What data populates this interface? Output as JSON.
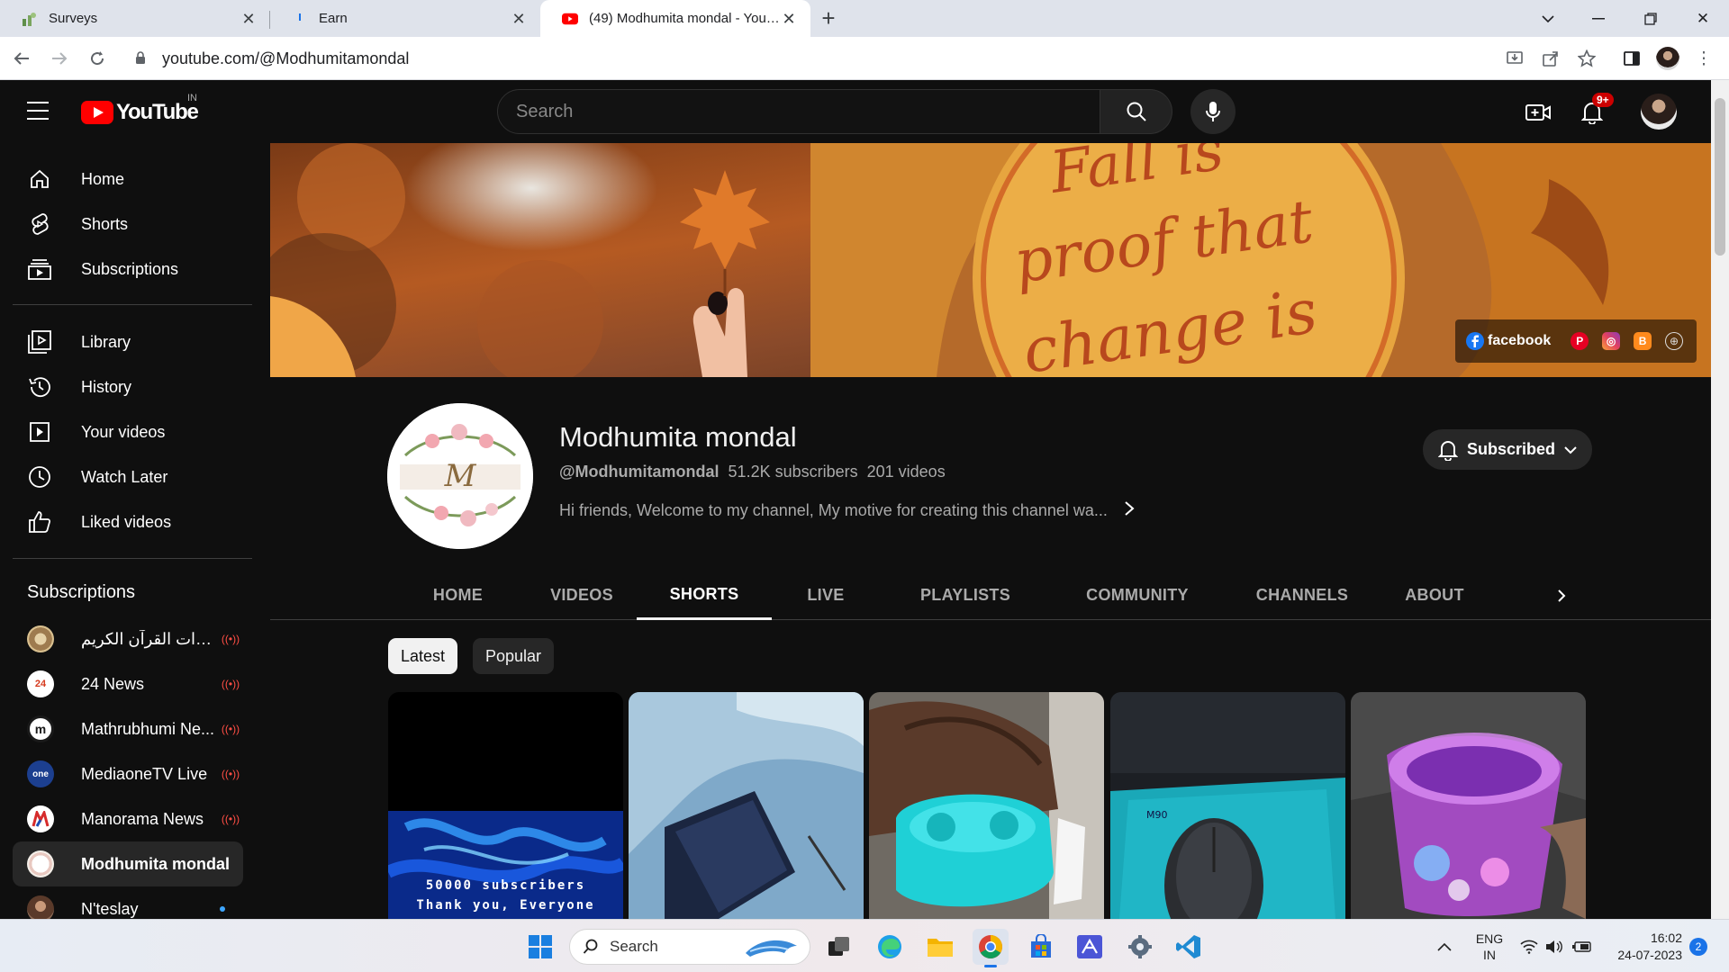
{
  "browser": {
    "tabs": [
      {
        "title": "Surveys"
      },
      {
        "title": "Earn"
      },
      {
        "title": "(49) Modhumita mondal - YouTube"
      }
    ],
    "url": "youtube.com/@Modhumitamondal"
  },
  "header": {
    "logo_text": "YouTube",
    "region": "IN",
    "search_placeholder": "Search",
    "notification_count": "9+"
  },
  "sidebar": {
    "main": [
      {
        "label": "Home",
        "icon": "home-icon"
      },
      {
        "label": "Shorts",
        "icon": "shorts-icon"
      },
      {
        "label": "Subscriptions",
        "icon": "subscriptions-icon"
      }
    ],
    "library": [
      {
        "label": "Library",
        "icon": "library-icon"
      },
      {
        "label": "History",
        "icon": "history-icon"
      },
      {
        "label": "Your videos",
        "icon": "your-videos-icon"
      },
      {
        "label": "Watch Later",
        "icon": "watch-later-icon"
      },
      {
        "label": "Liked videos",
        "icon": "liked-videos-icon"
      }
    ],
    "subscriptions_heading": "Subscriptions",
    "subscriptions": [
      {
        "name": "ل تلاوات القرآن الكريم...",
        "status": "live",
        "color": "#b89a6a"
      },
      {
        "name": "24 News",
        "status": "live",
        "color": "#f4f4f4"
      },
      {
        "name": "Mathrubhumi Ne...",
        "status": "live",
        "color": "#ffffff"
      },
      {
        "name": "MediaoneTV Live",
        "status": "live",
        "color": "#1c3f8f"
      },
      {
        "name": "Manorama News",
        "status": "live",
        "color": "#ffffff"
      },
      {
        "name": "Modhumita mondal",
        "status": "active",
        "color": "#e8e0d8"
      },
      {
        "name": "N'teslay",
        "status": "new",
        "color": "#6b4a3a"
      }
    ]
  },
  "banner": {
    "quote": "Fall is proof that change is",
    "social": {
      "facebook_label": "facebook"
    }
  },
  "channel": {
    "name": "Modhumita mondal",
    "handle": "@Modhumitamondal",
    "subscribers": "51.2K subscribers",
    "videos": "201 videos",
    "description": "Hi friends, Welcome to my channel, My motive for creating this channel wa...",
    "subscribe_label": "Subscribed",
    "avatar_letter": "M"
  },
  "tabs": [
    "HOME",
    "VIDEOS",
    "SHORTS",
    "LIVE",
    "PLAYLISTS",
    "COMMUNITY",
    "CHANNELS",
    "ABOUT"
  ],
  "active_tab": "SHORTS",
  "chips": [
    "Latest",
    "Popular"
  ],
  "active_chip": "Latest",
  "shorts": [
    {
      "caption_line1": "50000 subscribers",
      "caption_line2": "Thank you, Everyone"
    },
    {
      "caption_line1": "",
      "caption_line2": ""
    },
    {
      "caption_line1": "",
      "caption_line2": ""
    },
    {
      "caption_line1": "",
      "caption_line2": ""
    },
    {
      "caption_line1": "",
      "caption_line2": ""
    }
  ],
  "taskbar": {
    "search_label": "Search",
    "lang_line1": "ENG",
    "lang_line2": "IN",
    "time": "16:02",
    "date": "24-07-2023",
    "notification_count": "2"
  }
}
